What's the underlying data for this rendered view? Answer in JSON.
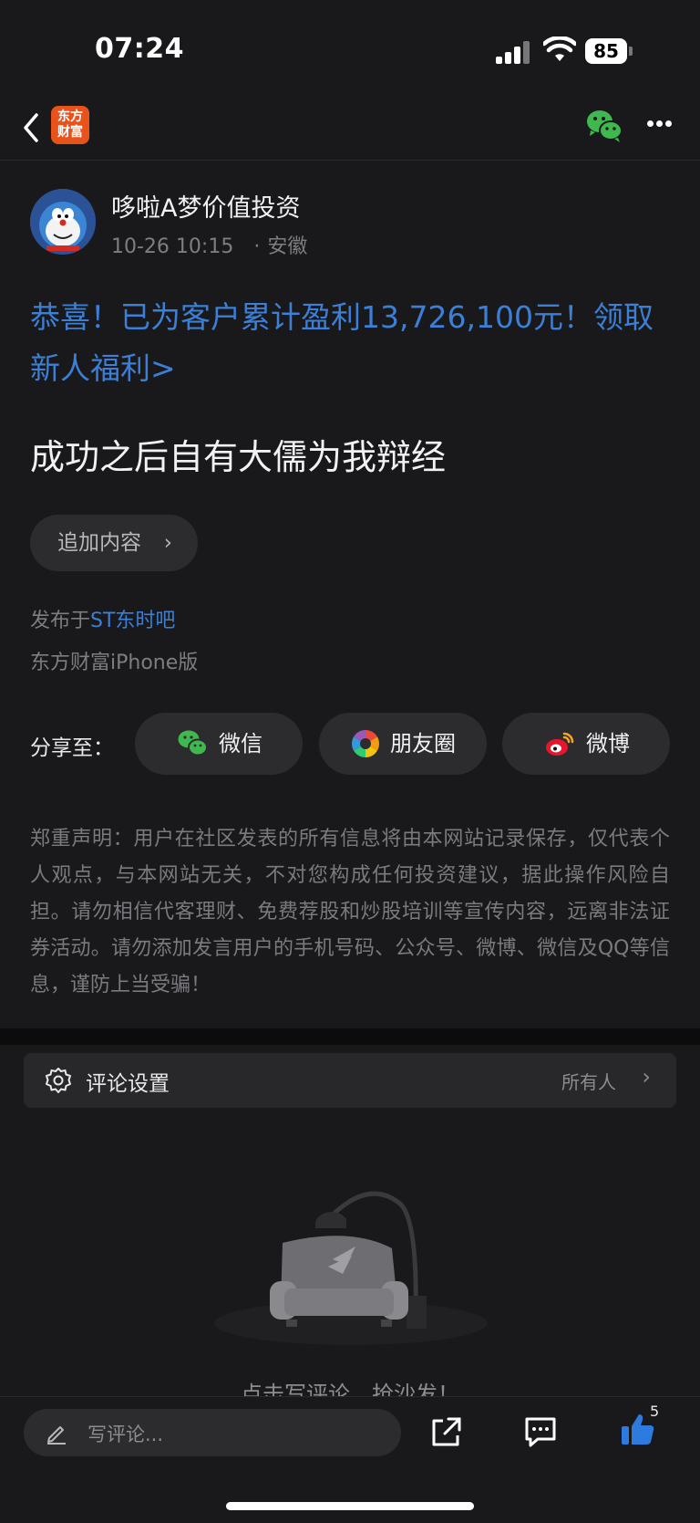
{
  "status_bar": {
    "time": "07:24",
    "battery": "85"
  },
  "nav": {
    "app_logo_line1": "东方",
    "app_logo_line2": "财富",
    "wechat_icon": "wechat-icon",
    "more_icon": "more-dots-icon"
  },
  "post": {
    "author": "哆啦A梦价值投资",
    "datetime": "10-26 10:15",
    "location": "安徽",
    "promo": "恭喜！已为客户累计盈利13,726,100元！领取新人福利>",
    "title": "成功之后自有大儒为我辩经",
    "append_label": "追加内容",
    "published_prefix": "发布于",
    "board": "ST东时吧",
    "client": "东方财富iPhone版"
  },
  "share": {
    "label": "分享至：",
    "targets": [
      {
        "label": "微信",
        "icon": "wechat-icon"
      },
      {
        "label": "朋友圈",
        "icon": "moments-icon"
      },
      {
        "label": "微博",
        "icon": "weibo-icon"
      }
    ]
  },
  "disclaimer": "郑重声明：用户在社区发表的所有信息将由本网站记录保存，仅代表个人观点，与本网站无关，不对您构成任何投资建议，据此操作风险自担。请勿相信代客理财、免费荐股和炒股培训等宣传内容，远离非法证券活动。请勿添加发言用户的手机号码、公众号、微博、微信及QQ等信息，谨防上当受骗！",
  "comments": {
    "settings_label": "评论设置",
    "settings_value": "所有人",
    "empty_text": "点击写评论，抢沙发！"
  },
  "bottom_bar": {
    "input_placeholder": "写评论...",
    "like_count": "5"
  },
  "colors": {
    "accent": "#3b7fd6",
    "background": "#19191b",
    "logo": "#e8531c"
  }
}
